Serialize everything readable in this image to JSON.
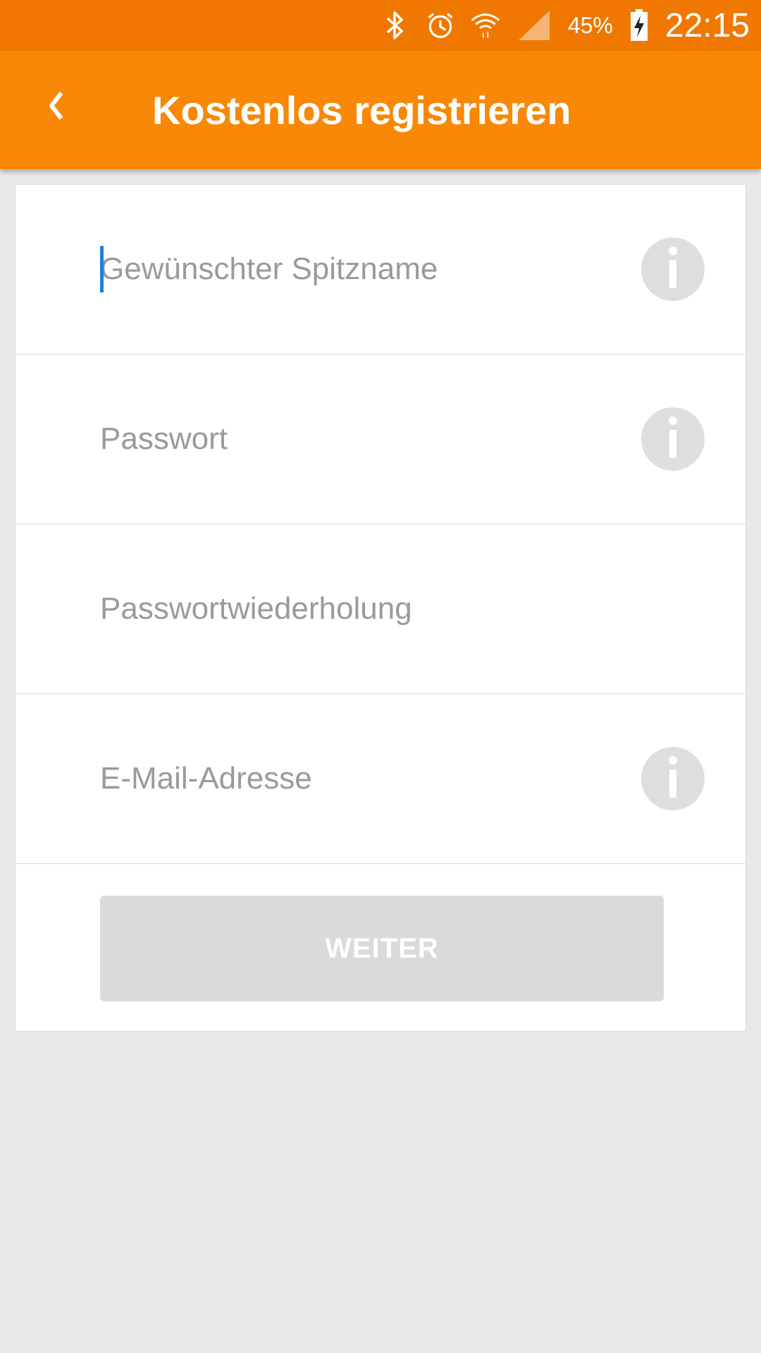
{
  "status_bar": {
    "battery_percent": "45%",
    "time": "22:15",
    "icons": [
      "bluetooth-icon",
      "alarm-icon",
      "wifi-icon",
      "cell-signal-icon",
      "battery-charging-icon"
    ]
  },
  "app_bar": {
    "back_icon": "chevron-left-icon",
    "title": "Kostenlos registrieren"
  },
  "form": {
    "fields": [
      {
        "placeholder": "Gewünschter Spitzname",
        "value": "",
        "has_info": true
      },
      {
        "placeholder": "Passwort",
        "value": "",
        "has_info": true
      },
      {
        "placeholder": "Passwortwiederholung",
        "value": "",
        "has_info": false
      },
      {
        "placeholder": "E-Mail-Adresse",
        "value": "",
        "has_info": true
      }
    ],
    "submit_label": "WEITER"
  },
  "colors": {
    "status_bar": "#f07800",
    "app_bar": "#f88805",
    "background": "#e8e8e8",
    "button_disabled": "#dadada",
    "caret": "#1e7fd8"
  }
}
